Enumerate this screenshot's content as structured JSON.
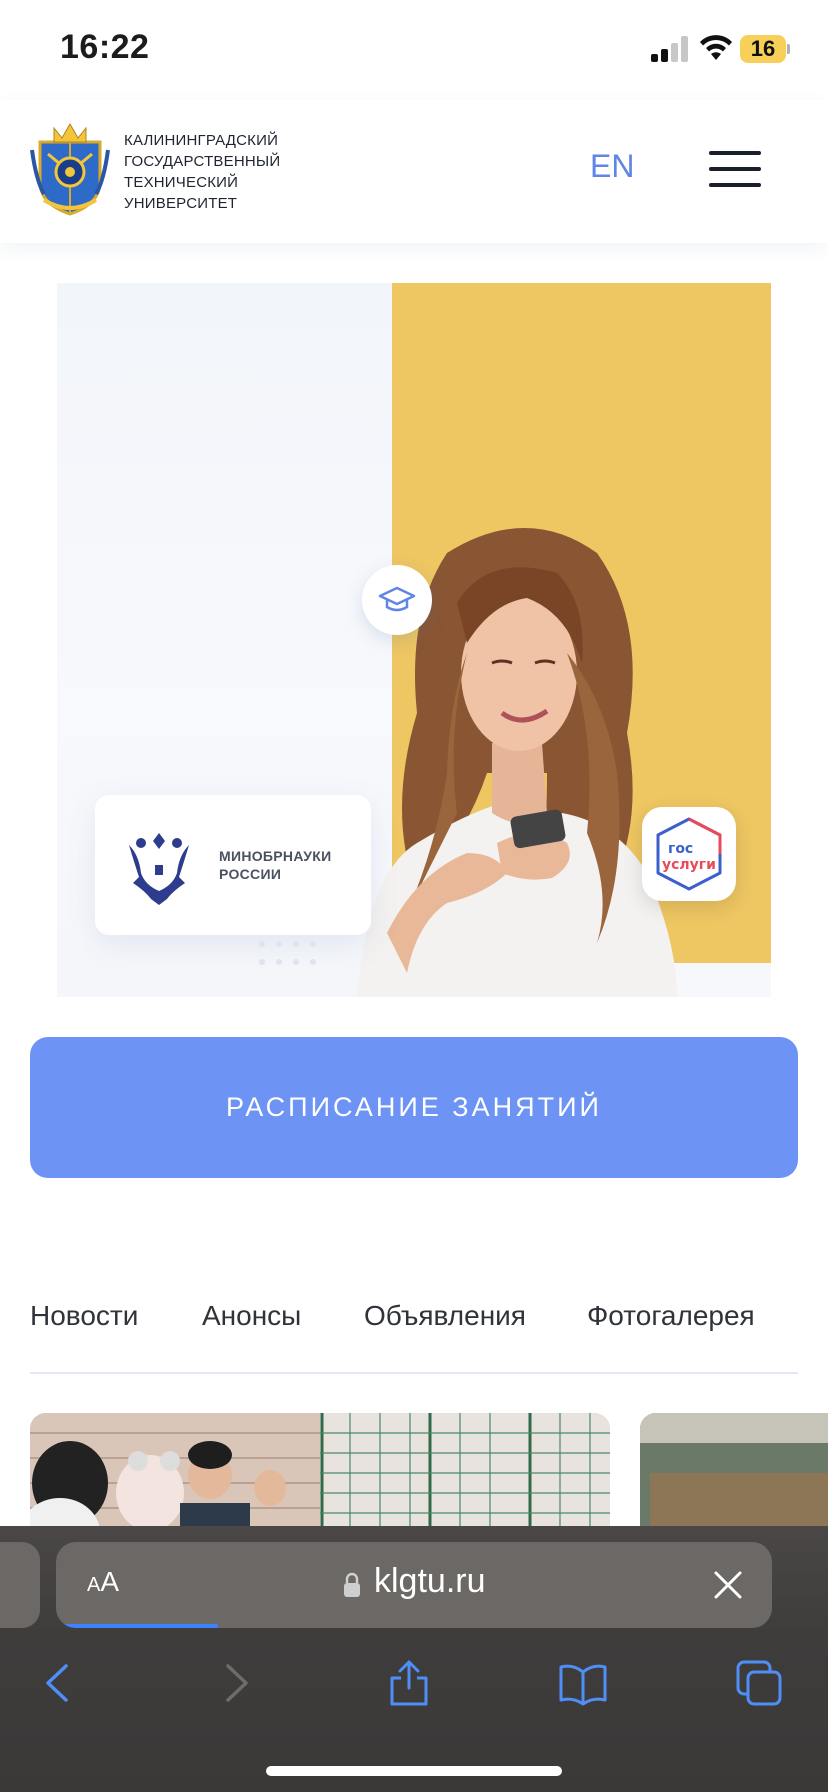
{
  "status_bar": {
    "time": "16:22",
    "battery": "16"
  },
  "header": {
    "university_name_lines": [
      "КАЛИНИНГРАДСКИЙ",
      "ГОСУДАРСТВЕННЫЙ",
      "ТЕХНИЧЕСКИЙ",
      "УНИВЕРСИТЕТ"
    ],
    "lang_label": "EN"
  },
  "banner": {
    "minobr_lines": [
      "МИНОБРНАУКИ",
      "РОССИИ"
    ],
    "gosuslugi_lines": [
      "гос",
      "услуги"
    ]
  },
  "cta": {
    "label": "РАСПИСАНИЕ ЗАНЯТИЙ"
  },
  "tabs": [
    "Новости",
    "Анонсы",
    "Объявления",
    "Фотогалерея"
  ],
  "browser": {
    "text_size_label_small": "A",
    "text_size_label_large": "A",
    "url": "klgtu.ru",
    "load_progress": 0.22
  },
  "colors": {
    "accent": "#6d94f4",
    "lang": "#5f86e6",
    "banner_yellow": "#eec662",
    "battery": "#f7d05a"
  }
}
